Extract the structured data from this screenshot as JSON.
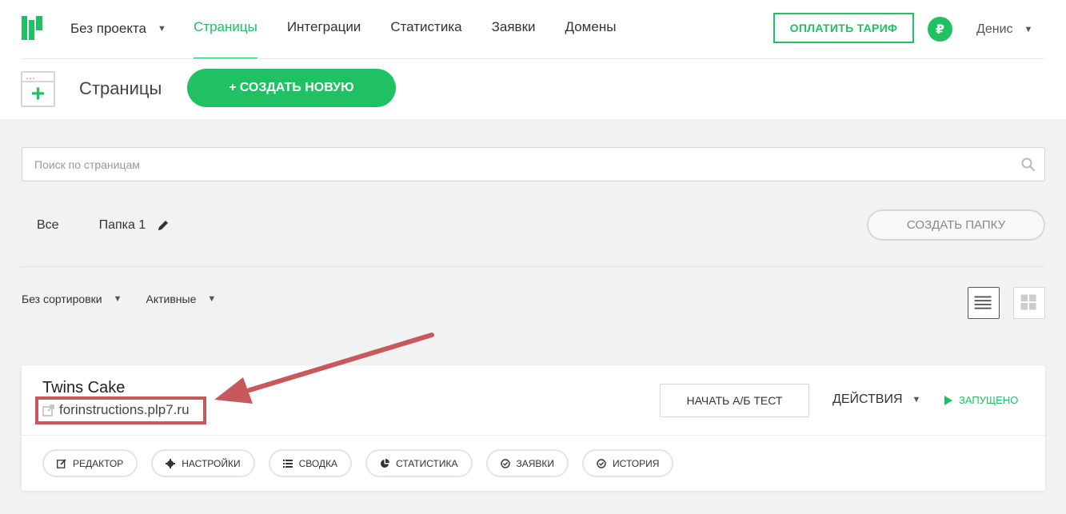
{
  "header": {
    "project": "Без проекта",
    "nav": [
      {
        "label": "Страницы",
        "active": true
      },
      {
        "label": "Интеграции",
        "active": false
      },
      {
        "label": "Статистика",
        "active": false
      },
      {
        "label": "Заявки",
        "active": false
      },
      {
        "label": "Домены",
        "active": false
      }
    ],
    "pay_button": "ОПЛАТИТЬ ТАРИФ",
    "currency_symbol": "₽",
    "user": "Денис"
  },
  "subbar": {
    "title": "Страницы",
    "create_button": "СОЗДАТЬ НОВУЮ",
    "create_plus": "+"
  },
  "search": {
    "placeholder": "Поиск по страницам",
    "value": ""
  },
  "folders": {
    "items": [
      "Все",
      "Папка 1"
    ],
    "create_button": "СОЗДАТЬ ПАПКУ"
  },
  "filters": {
    "sort": "Без сортировки",
    "state": "Активные"
  },
  "card": {
    "title": "Twins Cake",
    "link": "forinstructions.plp7.ru",
    "ab_test_button": "НАЧАТЬ А/Б ТЕСТ",
    "actions": "ДЕЙСТВИЯ",
    "status": "ЗАПУЩЕНО",
    "buttons": [
      {
        "label": "РЕДАКТОР",
        "icon": "edit-icon"
      },
      {
        "label": "НАСТРОЙКИ",
        "icon": "gear-icon"
      },
      {
        "label": "СВОДКА",
        "icon": "list-icon"
      },
      {
        "label": "СТАТИСТИКА",
        "icon": "pie-chart-icon"
      },
      {
        "label": "ЗАЯВКИ",
        "icon": "check-circle-icon"
      },
      {
        "label": "ИСТОРИЯ",
        "icon": "check-circle-icon"
      }
    ]
  },
  "colors": {
    "accent": "#1fc162",
    "highlight": "#c9585c"
  }
}
